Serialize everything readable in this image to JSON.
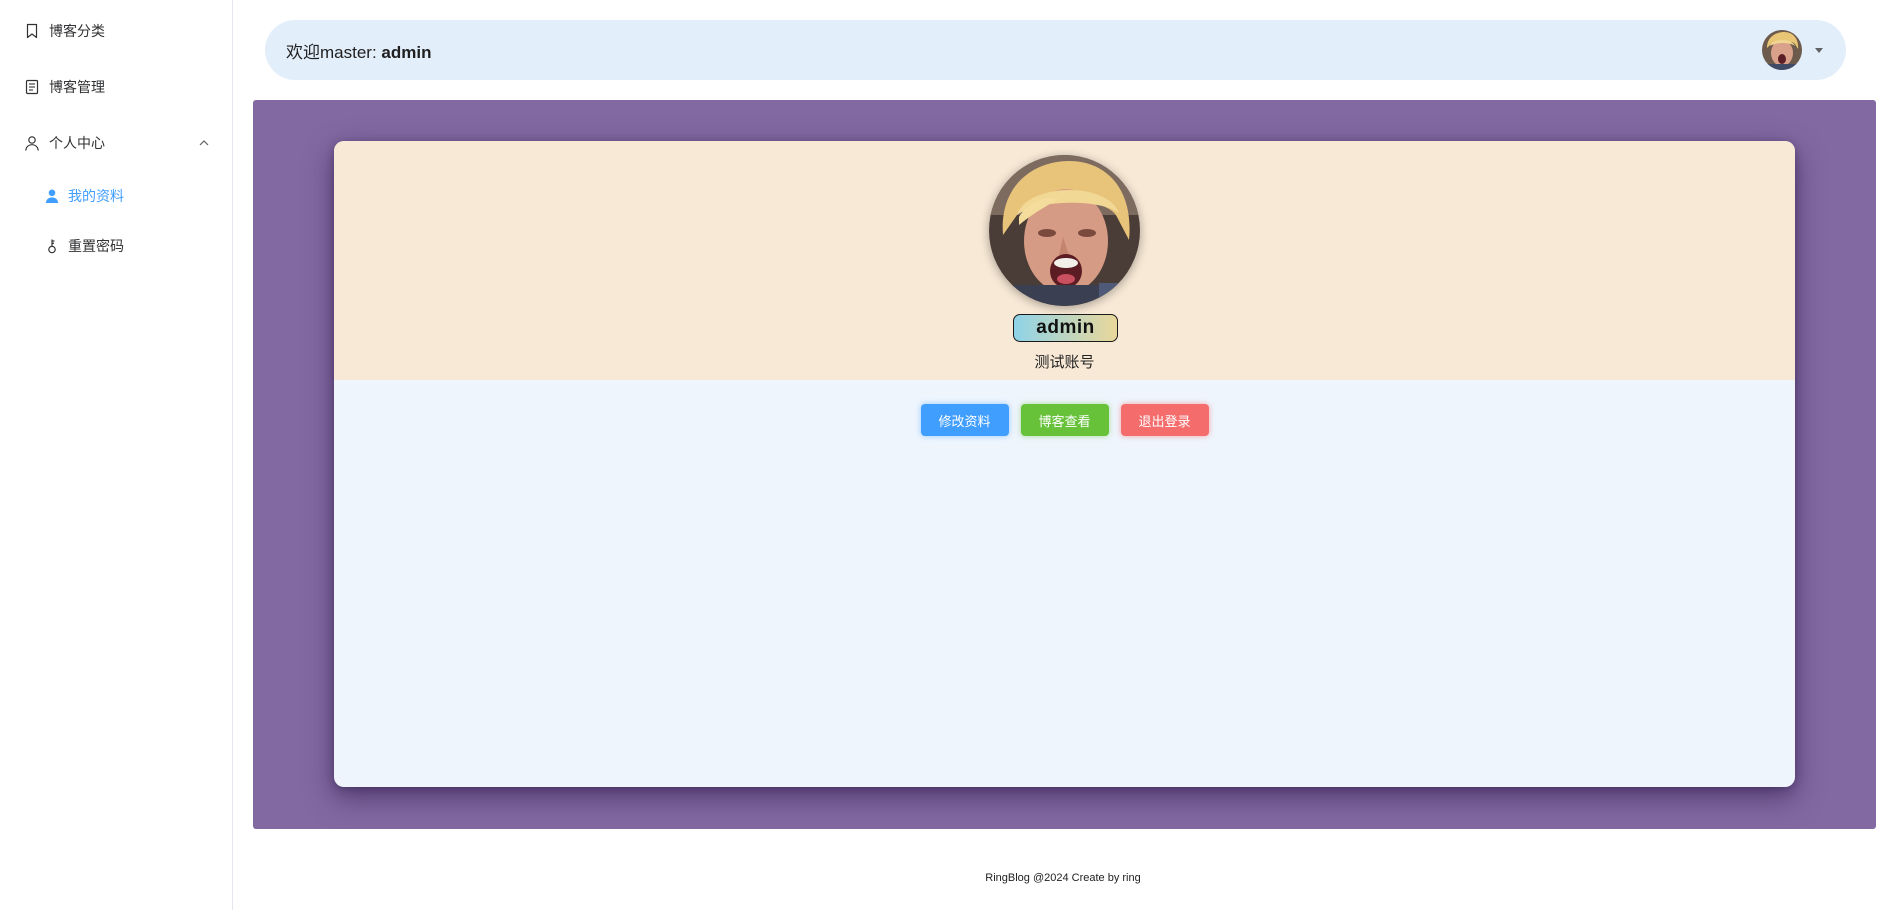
{
  "sidebar": {
    "items": [
      {
        "label": "博客分类",
        "icon": "bookmark-icon"
      },
      {
        "label": "博客管理",
        "icon": "document-icon"
      },
      {
        "label": "个人中心",
        "icon": "user-icon",
        "expanded": true
      }
    ],
    "subitems": [
      {
        "label": "我的资料",
        "icon": "user-filled-icon",
        "active": true
      },
      {
        "label": "重置密码",
        "icon": "key-icon",
        "active": false
      }
    ]
  },
  "header": {
    "welcome_prefix": "欢迎master: ",
    "username": "admin",
    "avatar": "user-avatar",
    "dropdown_icon": "caret-down-icon"
  },
  "profile": {
    "username": "admin",
    "description": "测试账号",
    "buttons": {
      "edit": "修改资料",
      "view_blog": "博客查看",
      "logout": "退出登录"
    }
  },
  "footer": {
    "text": "RingBlog @2024 Create by ring"
  },
  "colors": {
    "accent": "#409eff",
    "success": "#67c23a",
    "danger": "#f56c6c",
    "panel": "#8269a1",
    "card_top": "#f8e9d6",
    "card_body": "#eef5fd",
    "header_bg": "#e3eefb"
  }
}
